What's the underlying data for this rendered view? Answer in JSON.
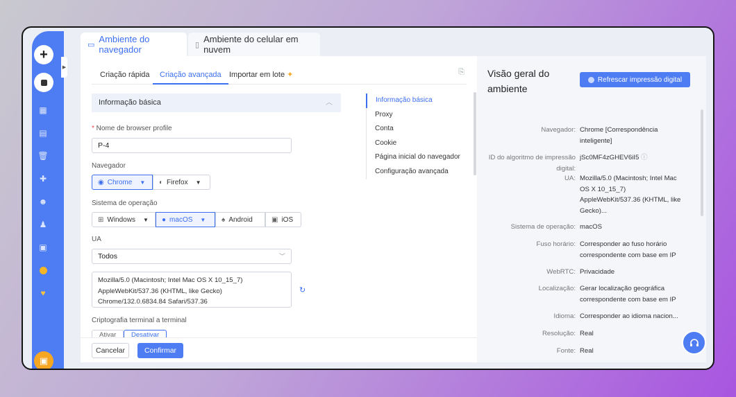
{
  "top_tabs": [
    {
      "label": "Ambiente do navegador",
      "icon": "monitor-icon"
    },
    {
      "label": "Ambiente do celular em nuvem",
      "icon": "phone-icon"
    }
  ],
  "sub_tabs": [
    "Criação rápida",
    "Criação avançada",
    "Importar em lote"
  ],
  "section_title": "Informação básica",
  "form": {
    "name_label": "Nome de browser profile",
    "name_value": "P-4",
    "browser_label": "Navegador",
    "browser_options": [
      "Chrome",
      "Firefox"
    ],
    "os_label": "Sistema de operação",
    "os_options": [
      "Windows",
      "macOS",
      "Android",
      "iOS"
    ],
    "ua_label": "UA",
    "ua_select": "Todos",
    "ua_lines": [
      "Mozilla/5.0 (Macintosh; Intel Mac OS X 10_15_7)",
      "AppleWebKit/537.36 (KHTML, like Gecko)",
      "Chrome/132.0.6834.84 Safari/537.36"
    ],
    "crypto_label": "Criptografia terminal a terminal",
    "crypto_options": [
      "Ativar",
      "Desativar"
    ]
  },
  "anchor_nav": [
    "Informação básica",
    "Proxy",
    "Conta",
    "Cookie",
    "Página inicial do navegador",
    "Configuração avançada"
  ],
  "footer": {
    "cancel": "Cancelar",
    "confirm": "Confirmar"
  },
  "overview": {
    "title": "Visão geral do ambiente",
    "refresh_button": "Refrescar impressão digital",
    "rows": [
      {
        "k": "Navegador:",
        "v": "Chrome [Correspondência inteligente]"
      },
      {
        "k": "ID do algoritmo de impressão digital:",
        "v": "jSc0MF4zGHEV6iI5"
      },
      {
        "k": "UA:",
        "v": "Mozilla/5.0 (Macintosh; Intel Mac OS X 10_15_7) AppleWebKit/537.36 (KHTML, like Gecko)..."
      },
      {
        "k": "Sistema de operação:",
        "v": "macOS"
      },
      {
        "k": "Fuso horário:",
        "v": "Corresponder ao fuso horário correspondente com base em IP"
      },
      {
        "k": "WebRTC:",
        "v": "Privacidade"
      },
      {
        "k": "Localização:",
        "v": "Gerar localização geográfica correspondente com base em IP"
      },
      {
        "k": "Idioma:",
        "v": "Corresponder ao idioma nacion..."
      },
      {
        "k": "Resolução:",
        "v": "Real"
      },
      {
        "k": "Fonte:",
        "v": "Real"
      }
    ]
  },
  "colors": {
    "accent": "#4e7cf2",
    "sidebar": "#4e7cf2"
  }
}
